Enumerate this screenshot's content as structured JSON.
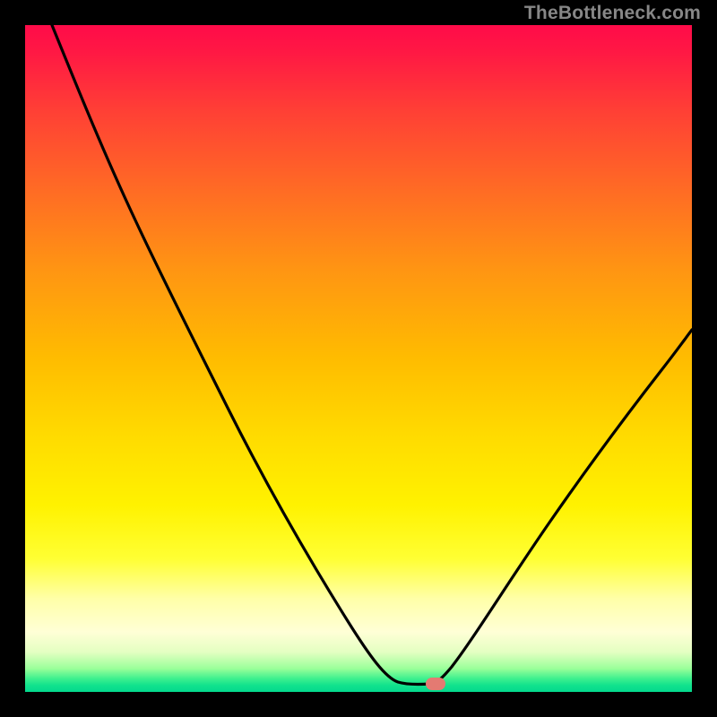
{
  "watermark": "TheBottleneck.com",
  "chart_data": {
    "type": "line",
    "title": "",
    "xlabel": "",
    "ylabel": "",
    "xlim": [
      0,
      100
    ],
    "ylim": [
      0,
      100
    ],
    "grid": false,
    "legend": false,
    "series": [
      {
        "name": "bottleneck-curve",
        "color": "#000000",
        "points": [
          {
            "x": 4.0,
            "y": 0.0
          },
          {
            "x": 12.0,
            "y": 20.0
          },
          {
            "x": 20.0,
            "y": 38.0
          },
          {
            "x": 27.0,
            "y": 52.0
          },
          {
            "x": 34.0,
            "y": 66.0
          },
          {
            "x": 42.0,
            "y": 80.0
          },
          {
            "x": 50.0,
            "y": 92.0
          },
          {
            "x": 55.0,
            "y": 98.0
          },
          {
            "x": 58.0,
            "y": 99.0
          },
          {
            "x": 61.0,
            "y": 99.0
          },
          {
            "x": 64.0,
            "y": 97.0
          },
          {
            "x": 70.0,
            "y": 88.0
          },
          {
            "x": 78.0,
            "y": 75.0
          },
          {
            "x": 86.0,
            "y": 62.0
          },
          {
            "x": 93.0,
            "y": 52.0
          },
          {
            "x": 100.0,
            "y": 44.0
          }
        ]
      }
    ],
    "marker": {
      "x": 61.5,
      "y": 99.0,
      "color": "#e47a72"
    },
    "gradient_colors": {
      "top": "#ff0b49",
      "mid": "#ffdc00",
      "bottom": "#03d98d"
    }
  }
}
